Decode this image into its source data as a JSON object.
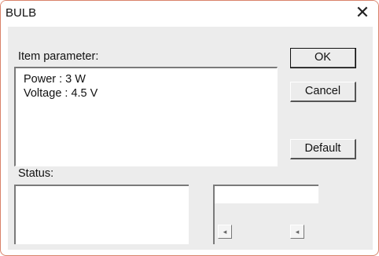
{
  "window": {
    "title": "BULB",
    "close_glyph": "✕"
  },
  "item_parameter": {
    "label": "Item parameter:",
    "lines": [
      "Power : 3 W",
      "Voltage : 4.5 V"
    ]
  },
  "buttons": {
    "ok": "OK",
    "cancel": "Cancel",
    "default": "Default"
  },
  "status": {
    "label": "Status:"
  },
  "scroll_buttons": {
    "left_glyph": "◂",
    "right_glyph": "◂"
  }
}
